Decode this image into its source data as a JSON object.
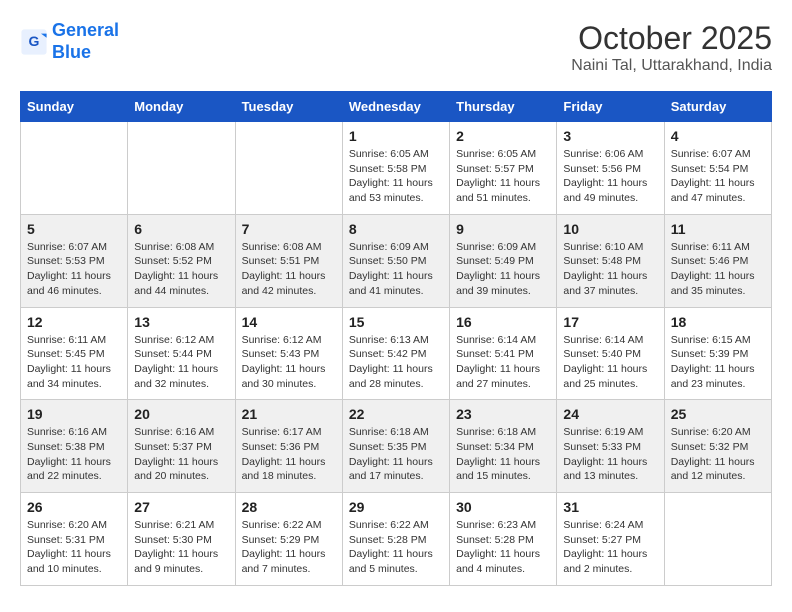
{
  "header": {
    "logo_line1": "General",
    "logo_line2": "Blue",
    "month": "October 2025",
    "location": "Naini Tal, Uttarakhand, India"
  },
  "weekdays": [
    "Sunday",
    "Monday",
    "Tuesday",
    "Wednesday",
    "Thursday",
    "Friday",
    "Saturday"
  ],
  "weeks": [
    [
      {
        "day": "",
        "sunrise": "",
        "sunset": "",
        "daylight": ""
      },
      {
        "day": "",
        "sunrise": "",
        "sunset": "",
        "daylight": ""
      },
      {
        "day": "",
        "sunrise": "",
        "sunset": "",
        "daylight": ""
      },
      {
        "day": "1",
        "sunrise": "Sunrise: 6:05 AM",
        "sunset": "Sunset: 5:58 PM",
        "daylight": "Daylight: 11 hours and 53 minutes."
      },
      {
        "day": "2",
        "sunrise": "Sunrise: 6:05 AM",
        "sunset": "Sunset: 5:57 PM",
        "daylight": "Daylight: 11 hours and 51 minutes."
      },
      {
        "day": "3",
        "sunrise": "Sunrise: 6:06 AM",
        "sunset": "Sunset: 5:56 PM",
        "daylight": "Daylight: 11 hours and 49 minutes."
      },
      {
        "day": "4",
        "sunrise": "Sunrise: 6:07 AM",
        "sunset": "Sunset: 5:54 PM",
        "daylight": "Daylight: 11 hours and 47 minutes."
      }
    ],
    [
      {
        "day": "5",
        "sunrise": "Sunrise: 6:07 AM",
        "sunset": "Sunset: 5:53 PM",
        "daylight": "Daylight: 11 hours and 46 minutes."
      },
      {
        "day": "6",
        "sunrise": "Sunrise: 6:08 AM",
        "sunset": "Sunset: 5:52 PM",
        "daylight": "Daylight: 11 hours and 44 minutes."
      },
      {
        "day": "7",
        "sunrise": "Sunrise: 6:08 AM",
        "sunset": "Sunset: 5:51 PM",
        "daylight": "Daylight: 11 hours and 42 minutes."
      },
      {
        "day": "8",
        "sunrise": "Sunrise: 6:09 AM",
        "sunset": "Sunset: 5:50 PM",
        "daylight": "Daylight: 11 hours and 41 minutes."
      },
      {
        "day": "9",
        "sunrise": "Sunrise: 6:09 AM",
        "sunset": "Sunset: 5:49 PM",
        "daylight": "Daylight: 11 hours and 39 minutes."
      },
      {
        "day": "10",
        "sunrise": "Sunrise: 6:10 AM",
        "sunset": "Sunset: 5:48 PM",
        "daylight": "Daylight: 11 hours and 37 minutes."
      },
      {
        "day": "11",
        "sunrise": "Sunrise: 6:11 AM",
        "sunset": "Sunset: 5:46 PM",
        "daylight": "Daylight: 11 hours and 35 minutes."
      }
    ],
    [
      {
        "day": "12",
        "sunrise": "Sunrise: 6:11 AM",
        "sunset": "Sunset: 5:45 PM",
        "daylight": "Daylight: 11 hours and 34 minutes."
      },
      {
        "day": "13",
        "sunrise": "Sunrise: 6:12 AM",
        "sunset": "Sunset: 5:44 PM",
        "daylight": "Daylight: 11 hours and 32 minutes."
      },
      {
        "day": "14",
        "sunrise": "Sunrise: 6:12 AM",
        "sunset": "Sunset: 5:43 PM",
        "daylight": "Daylight: 11 hours and 30 minutes."
      },
      {
        "day": "15",
        "sunrise": "Sunrise: 6:13 AM",
        "sunset": "Sunset: 5:42 PM",
        "daylight": "Daylight: 11 hours and 28 minutes."
      },
      {
        "day": "16",
        "sunrise": "Sunrise: 6:14 AM",
        "sunset": "Sunset: 5:41 PM",
        "daylight": "Daylight: 11 hours and 27 minutes."
      },
      {
        "day": "17",
        "sunrise": "Sunrise: 6:14 AM",
        "sunset": "Sunset: 5:40 PM",
        "daylight": "Daylight: 11 hours and 25 minutes."
      },
      {
        "day": "18",
        "sunrise": "Sunrise: 6:15 AM",
        "sunset": "Sunset: 5:39 PM",
        "daylight": "Daylight: 11 hours and 23 minutes."
      }
    ],
    [
      {
        "day": "19",
        "sunrise": "Sunrise: 6:16 AM",
        "sunset": "Sunset: 5:38 PM",
        "daylight": "Daylight: 11 hours and 22 minutes."
      },
      {
        "day": "20",
        "sunrise": "Sunrise: 6:16 AM",
        "sunset": "Sunset: 5:37 PM",
        "daylight": "Daylight: 11 hours and 20 minutes."
      },
      {
        "day": "21",
        "sunrise": "Sunrise: 6:17 AM",
        "sunset": "Sunset: 5:36 PM",
        "daylight": "Daylight: 11 hours and 18 minutes."
      },
      {
        "day": "22",
        "sunrise": "Sunrise: 6:18 AM",
        "sunset": "Sunset: 5:35 PM",
        "daylight": "Daylight: 11 hours and 17 minutes."
      },
      {
        "day": "23",
        "sunrise": "Sunrise: 6:18 AM",
        "sunset": "Sunset: 5:34 PM",
        "daylight": "Daylight: 11 hours and 15 minutes."
      },
      {
        "day": "24",
        "sunrise": "Sunrise: 6:19 AM",
        "sunset": "Sunset: 5:33 PM",
        "daylight": "Daylight: 11 hours and 13 minutes."
      },
      {
        "day": "25",
        "sunrise": "Sunrise: 6:20 AM",
        "sunset": "Sunset: 5:32 PM",
        "daylight": "Daylight: 11 hours and 12 minutes."
      }
    ],
    [
      {
        "day": "26",
        "sunrise": "Sunrise: 6:20 AM",
        "sunset": "Sunset: 5:31 PM",
        "daylight": "Daylight: 11 hours and 10 minutes."
      },
      {
        "day": "27",
        "sunrise": "Sunrise: 6:21 AM",
        "sunset": "Sunset: 5:30 PM",
        "daylight": "Daylight: 11 hours and 9 minutes."
      },
      {
        "day": "28",
        "sunrise": "Sunrise: 6:22 AM",
        "sunset": "Sunset: 5:29 PM",
        "daylight": "Daylight: 11 hours and 7 minutes."
      },
      {
        "day": "29",
        "sunrise": "Sunrise: 6:22 AM",
        "sunset": "Sunset: 5:28 PM",
        "daylight": "Daylight: 11 hours and 5 minutes."
      },
      {
        "day": "30",
        "sunrise": "Sunrise: 6:23 AM",
        "sunset": "Sunset: 5:28 PM",
        "daylight": "Daylight: 11 hours and 4 minutes."
      },
      {
        "day": "31",
        "sunrise": "Sunrise: 6:24 AM",
        "sunset": "Sunset: 5:27 PM",
        "daylight": "Daylight: 11 hours and 2 minutes."
      },
      {
        "day": "",
        "sunrise": "",
        "sunset": "",
        "daylight": ""
      }
    ]
  ]
}
